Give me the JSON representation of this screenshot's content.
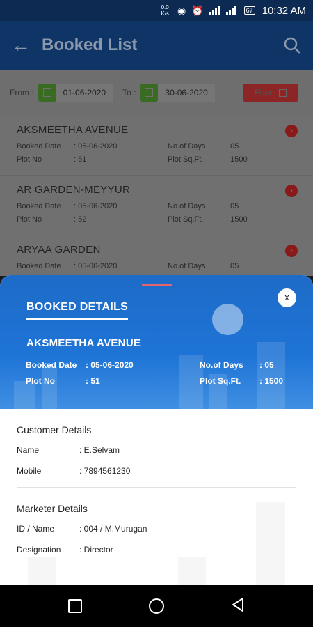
{
  "status_bar": {
    "net_speed": "0.0",
    "net_unit": "K/s",
    "battery": "67",
    "time": "10:32 AM"
  },
  "app_bar": {
    "title": "Booked List"
  },
  "filter": {
    "from_label": "From :",
    "from_date": "01-06-2020",
    "to_label": "To :",
    "to_date": "30-06-2020",
    "filter_label": "Filter"
  },
  "list_labels": {
    "booked_date": "Booked Date",
    "plot_no": "Plot No",
    "no_of_days": "No.of Days",
    "plot_sqft": "Plot Sq.Ft."
  },
  "bookings": [
    {
      "name": "AKSMEETHA AVENUE",
      "booked_date": ": 05-06-2020",
      "plot_no": ": 51",
      "no_of_days": ": 05",
      "plot_sqft": ": 1500"
    },
    {
      "name": "AR GARDEN-MEYYUR",
      "booked_date": ": 05-06-2020",
      "plot_no": ": 52",
      "no_of_days": ": 05",
      "plot_sqft": ": 1500"
    },
    {
      "name": "ARYAA GARDEN",
      "booked_date": ": 05-06-2020",
      "plot_no": "",
      "no_of_days": ": 05",
      "plot_sqft": ""
    }
  ],
  "sheet": {
    "title": "BOOKED DETAILS",
    "close_label": "x",
    "property": "AKSMEETHA AVENUE",
    "booked_date_label": "Booked Date",
    "booked_date": ": 05-06-2020",
    "plot_no_label": "Plot No",
    "plot_no": ": 51",
    "no_of_days_label": "No.of Days",
    "no_of_days": ": 05",
    "plot_sqft_label": "Plot Sq.Ft.",
    "plot_sqft": ": 1500",
    "customer": {
      "title": "Customer Details",
      "name_label": "Name",
      "name": ": E.Selvam",
      "mobile_label": "Mobile",
      "mobile": ": 7894561230"
    },
    "marketer": {
      "title": "Marketer Details",
      "id_label": "ID / Name",
      "id": ": 004 / M.Murugan",
      "designation_label": "Designation",
      "designation": ": Director"
    }
  }
}
